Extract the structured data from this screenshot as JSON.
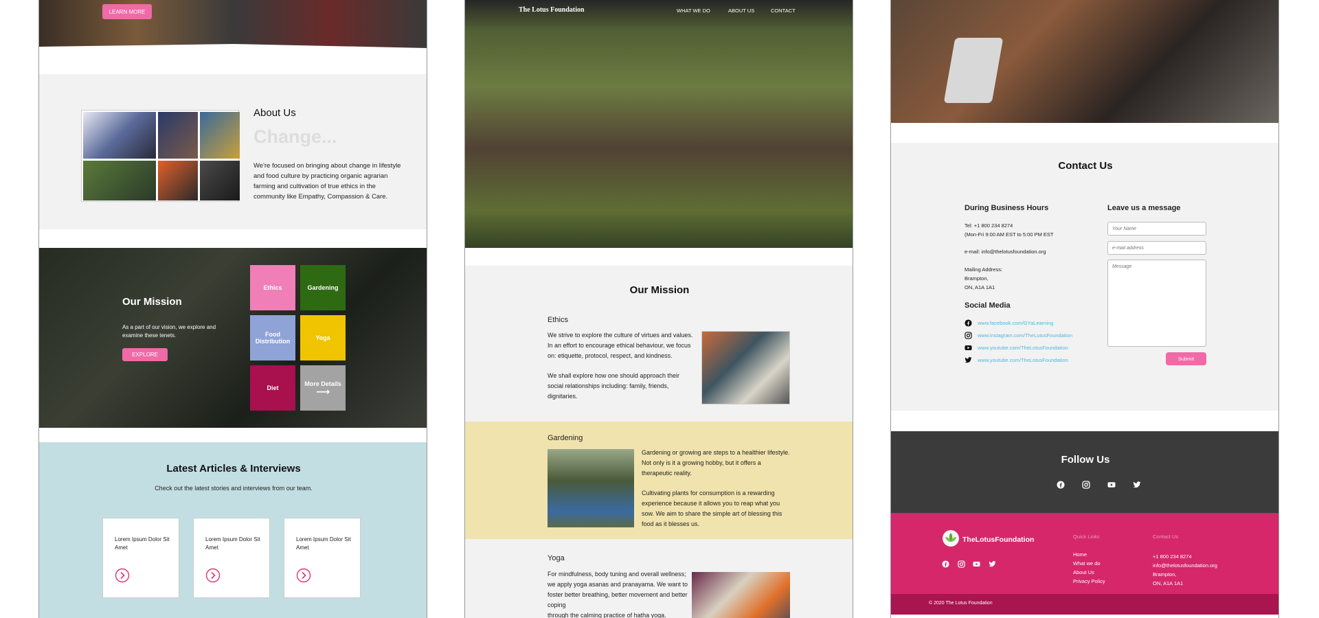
{
  "panel1": {
    "hero": {
      "button": "LEARN MORE"
    },
    "about": {
      "title": "About Us",
      "subtitle": "Change...",
      "body": "We're focused on bringing about change in lifestyle and food culture by practicing organic agrarian farming and cultivation of true ethics in the community like Empathy, Compassion & Care."
    },
    "mission": {
      "title": "Our Mission",
      "text": "As a part of our vision, we explore and examine these tenets.",
      "button": "EXPLORE",
      "tiles": [
        {
          "label": "Ethics",
          "color": "#ef7fb6"
        },
        {
          "label": "Gardening",
          "color": "#2e6a12"
        },
        {
          "label": "Food Distribution",
          "color": "#8fa3d6"
        },
        {
          "label": "Yoga",
          "color": "#f0c400"
        },
        {
          "label": "Diet",
          "color": "#a8104e"
        },
        {
          "label": "More Details",
          "color": "#a3a3a3"
        }
      ]
    },
    "articles": {
      "title": "Latest Articles & Interviews",
      "subtitle": "Check out the latest stories and interviews from our team.",
      "cards": [
        {
          "title": "Lorem Ipsum Dolor Sit Amet"
        },
        {
          "title": "Lorem Ipsum Dolor Sit Amet"
        },
        {
          "title": "Lorem Ipsum Dolor Sit Amet"
        }
      ]
    }
  },
  "panel2": {
    "nav": {
      "brand": "The Lotus Foundation",
      "links": [
        "WHAT WE DO",
        "ABOUT US",
        "CONTACT"
      ]
    },
    "mission_title": "Our Mission",
    "ethics": {
      "title": "Ethics",
      "p1": "We strive to explore the culture of virtues and values. In an effort to encourage ethical behaviour, we focus on: etiquette, protocol, respect, and kindness.",
      "p2": "We shall explore how one should approach their social relationships including: family, friends, dignitaries."
    },
    "gardening": {
      "title": "Gardening",
      "p1": "Gardening or growing are steps to a healthier lifestyle. Not only is it a growing hobby, but it offers a therapeutic reality.",
      "p2": "Cultivating plants for consumption is a rewarding experience because it allows you to reap what you sow. We aim to share the simple art of blessing this food as it blesses us."
    },
    "yoga": {
      "title": "Yoga",
      "p1": "For mindfulness, body tuning and overall wellness; we apply yoga asanas and pranayama.  We want to foster better breathing, better movement and better coping",
      "p2": "through the calming practice of hatha yoga."
    }
  },
  "panel3": {
    "contact": {
      "title": "Contact Us",
      "hours_title": "During Business Hours",
      "tel": "Tel: +1 800 234 8274",
      "hours": "(Mon-Fri 9:00 AM EST  to 5:00 PM EST",
      "email": "e-mail: info@thelotusfoundation.org",
      "mail_label": "Mailing Address:",
      "mail_city": "Brampton,",
      "mail_prov": "ON, A1A 1A1",
      "social_title": "Social Media",
      "social": [
        {
          "icon": "facebook-icon",
          "text": "www.facebook.com/GYaLearning"
        },
        {
          "icon": "instagram-icon",
          "text": "www.instagram.com/TheLotusFoundation"
        },
        {
          "icon": "youtube-icon",
          "text": "www.youtube.com/TheLotusFoundation"
        },
        {
          "icon": "twitter-icon",
          "text": "www.youtube.com/TheLotusFoundation"
        }
      ],
      "form_title": "Leave us a message",
      "name_placeholder": "Your Name",
      "email_placeholder": "e-mail address",
      "message_placeholder": "Message",
      "submit": "Submit"
    },
    "follow": {
      "title": "Follow Us"
    },
    "footer": {
      "brand": "TheLotusFoundation",
      "quick_title": "Quick Links",
      "quick_links": [
        "Home",
        "What we do",
        "About Us",
        "Privacy Policy"
      ],
      "contact_title": "Contact Us",
      "contact_lines": [
        "+1 800 234 8274",
        "info@thelotusfoundation.org",
        "Brampton,",
        "ON, A1A 1A1"
      ],
      "copyright": "© 2020 The Lotus Foundation"
    }
  },
  "colors": {
    "accent_pink": "#ef6aa6",
    "footer_pink": "#d6276a",
    "footer_bottom": "#a8154f",
    "articles_bg": "#c2dee2",
    "gardening_bg": "#f0e3ad",
    "follow_bg": "#3b3b3b",
    "link_blue": "#4fb6e0"
  }
}
